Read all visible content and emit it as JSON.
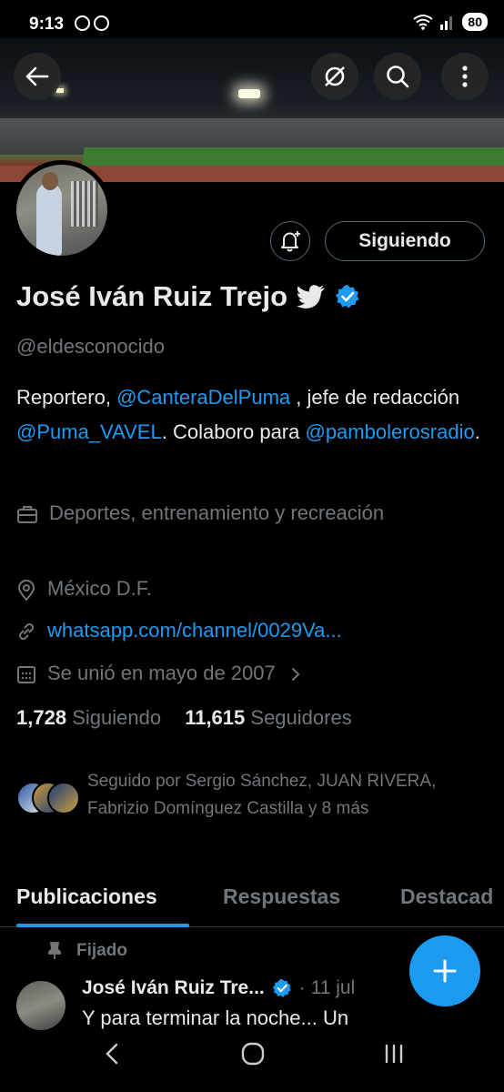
{
  "status_bar": {
    "time": "9:13",
    "battery": "80"
  },
  "profile": {
    "name": "José Iván Ruiz Trejo",
    "handle": "@eldesconocido",
    "follow_button": "Siguiendo",
    "bio": {
      "p1": "Reportero, ",
      "l1": "@CanteraDelPuma",
      "p2": " , jefe de redacción ",
      "l2": "@Puma_VAVEL",
      "p3": ". Colaboro para ",
      "l3": "@pambolerosradio",
      "p4": "."
    },
    "category": "Deportes, entrenamiento y recreación",
    "location": "México D.F.",
    "website": "whatsapp.com/channel/0029Va...",
    "joined": "Se unió en mayo de 2007",
    "following_count": "1,728",
    "following_label": "Siguiendo",
    "followers_count": "11,615",
    "followers_label": "Seguidores",
    "followed_by": "Seguido por Sergio Sánchez, JUAN RIVERA, Fabrizio Domínguez Castilla y 8 más"
  },
  "tabs": [
    {
      "label": "Publicaciones",
      "active": true
    },
    {
      "label": "Respuestas",
      "active": false
    },
    {
      "label": "Destacad",
      "active": false
    }
  ],
  "pinned_post": {
    "pinned_label": "Fijado",
    "author": "José Iván Ruiz Tre...",
    "date": "· 11 jul",
    "text": "Y para terminar la noche... Un"
  },
  "colors": {
    "accent": "#1d9bf0",
    "background": "#000000",
    "muted": "#71767b"
  }
}
